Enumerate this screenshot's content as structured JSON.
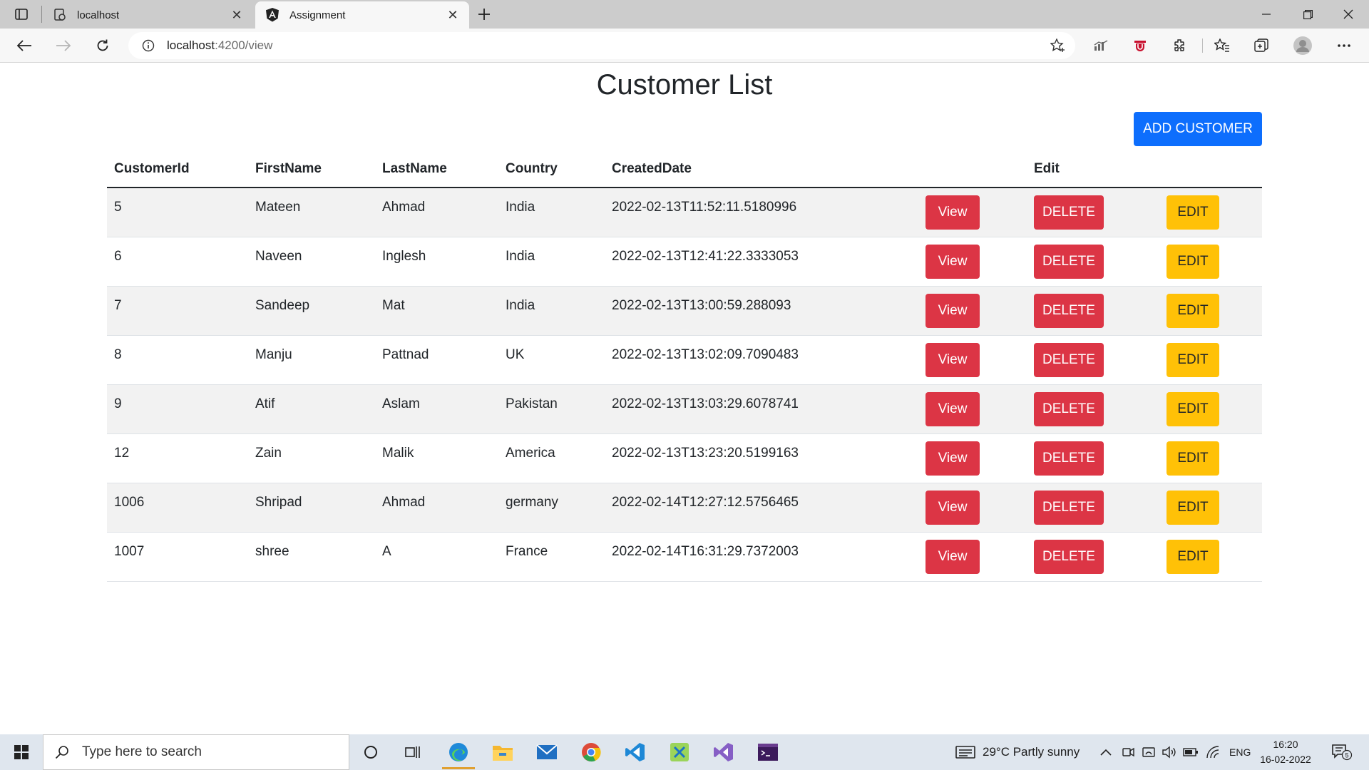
{
  "browser": {
    "tabs": [
      {
        "title": "localhost",
        "favicon": "page-refresh-icon"
      },
      {
        "title": "Assignment",
        "favicon": "angular-logo-icon"
      }
    ],
    "url_host": "localhost",
    "url_path": ":4200/view"
  },
  "page": {
    "title": "Customer List",
    "add_button_label": "ADD CUSTOMER",
    "columns": [
      "CustomerId",
      "FirstName",
      "LastName",
      "Country",
      "CreatedDate",
      "",
      "Edit",
      ""
    ],
    "rows": [
      {
        "id": "5",
        "first": "Mateen",
        "last": "Ahmad",
        "country": "India",
        "created": "2022-02-13T11:52:11.5180996"
      },
      {
        "id": "6",
        "first": "Naveen",
        "last": "Inglesh",
        "country": "India",
        "created": "2022-02-13T12:41:22.3333053"
      },
      {
        "id": "7",
        "first": "Sandeep",
        "last": "Mat",
        "country": "India",
        "created": "2022-02-13T13:00:59.288093"
      },
      {
        "id": "8",
        "first": "Manju",
        "last": "Pattnad",
        "country": "UK",
        "created": "2022-02-13T13:02:09.7090483"
      },
      {
        "id": "9",
        "first": "Atif",
        "last": "Aslam",
        "country": "Pakistan",
        "created": "2022-02-13T13:03:29.6078741"
      },
      {
        "id": "12",
        "first": "Zain",
        "last": "Malik",
        "country": "America",
        "created": "2022-02-13T13:23:20.5199163"
      },
      {
        "id": "1006",
        "first": "Shripad",
        "last": "Ahmad",
        "country": "germany",
        "created": "2022-02-14T12:27:12.5756465"
      },
      {
        "id": "1007",
        "first": "shree",
        "last": "A",
        "country": "France",
        "created": "2022-02-14T16:31:29.7372003"
      }
    ],
    "row_buttons": {
      "view": "View",
      "delete": "DELETE",
      "edit": "EDIT"
    },
    "colors": {
      "primary": "#0d6efd",
      "danger": "#dc3545",
      "warning": "#ffc107"
    }
  },
  "taskbar": {
    "search_placeholder": "Type here to search",
    "weather": "29°C  Partly sunny",
    "language": "ENG",
    "time": "16:20",
    "date": "16-02-2022",
    "notification_count": "5"
  }
}
